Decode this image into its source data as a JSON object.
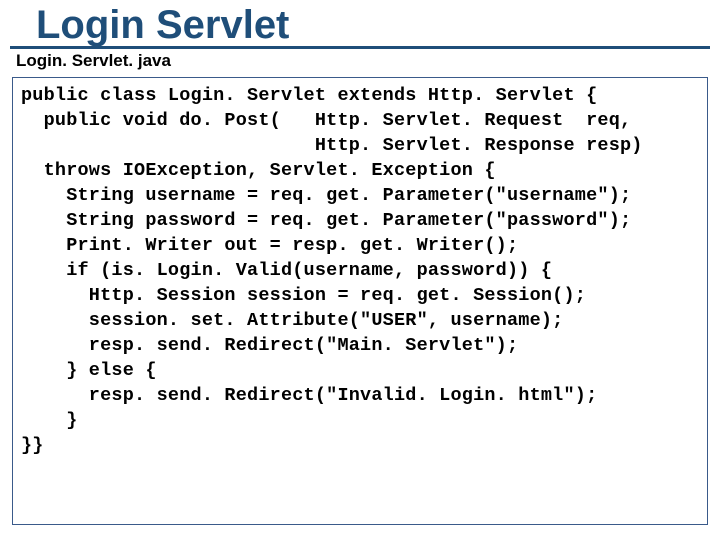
{
  "title": "Login Servlet",
  "subtitle": "Login. Servlet. java",
  "code": "public class Login. Servlet extends Http. Servlet {\n  public void do. Post(   Http. Servlet. Request  req,\n                          Http. Servlet. Response resp)\n  throws IOException, Servlet. Exception {\n    String username = req. get. Parameter(\"username\");\n    String password = req. get. Parameter(\"password\");\n    Print. Writer out = resp. get. Writer();\n    if (is. Login. Valid(username, password)) {\n      Http. Session session = req. get. Session();\n      session. set. Attribute(\"USER\", username);\n      resp. send. Redirect(\"Main. Servlet\");\n    } else {\n      resp. send. Redirect(\"Invalid. Login. html\");\n    }\n}}"
}
